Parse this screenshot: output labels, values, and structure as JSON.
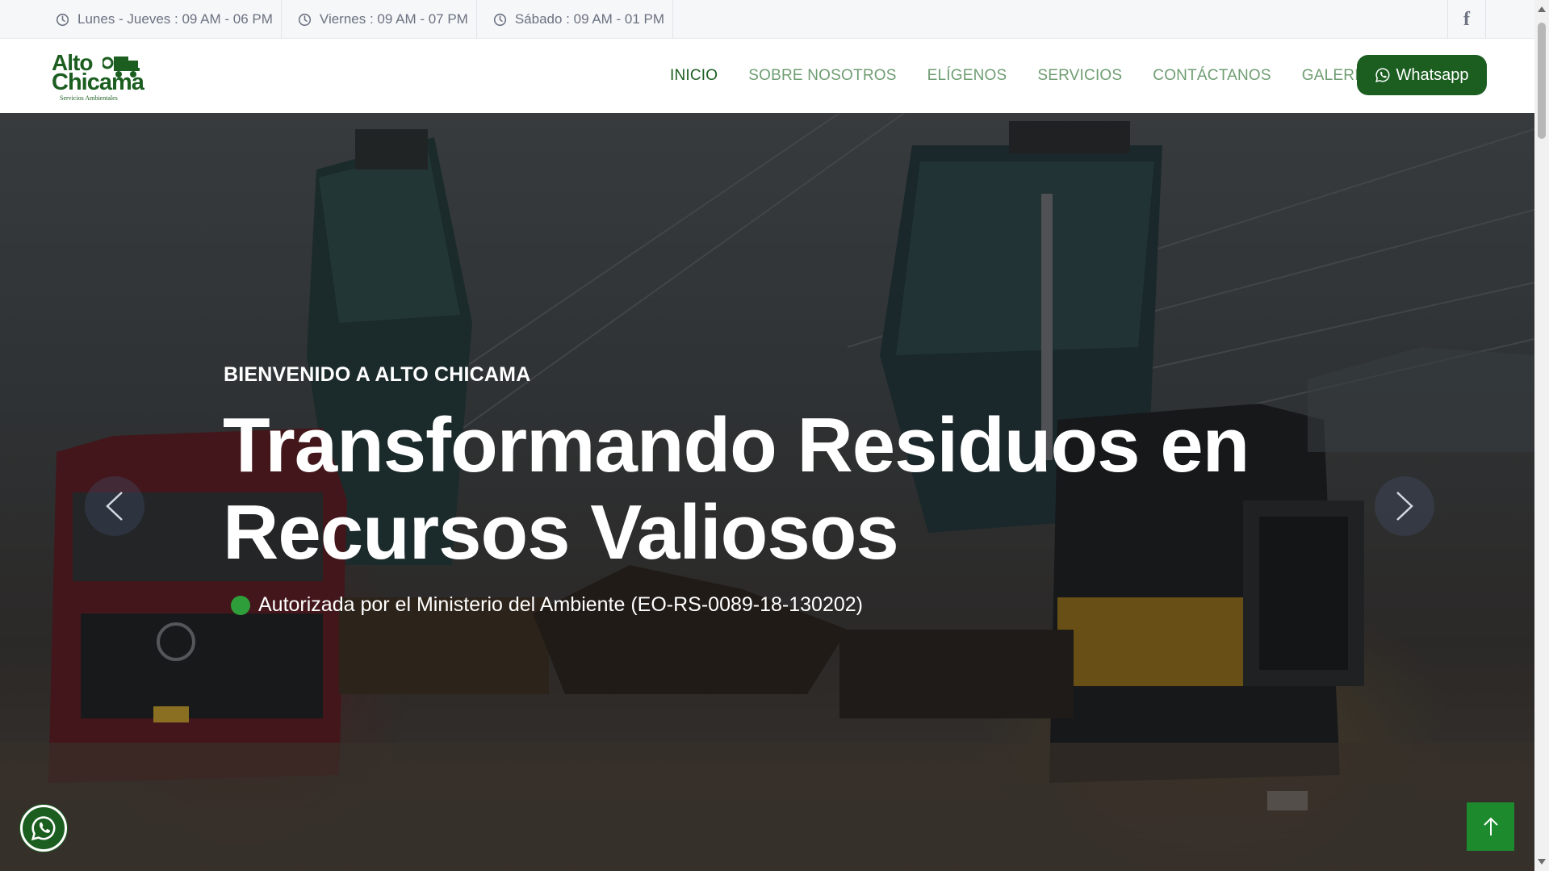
{
  "topbar": {
    "hours": [
      {
        "label": "Lunes - Jueves : 09 AM - 06 PM"
      },
      {
        "label": "Viernes : 09 AM - 07 PM"
      },
      {
        "label": "Sábado : 09 AM - 01 PM"
      }
    ],
    "social_icon": "facebook-icon",
    "social_glyph": "f"
  },
  "logo": {
    "line1": "Alto",
    "line2": "Chicama",
    "tagline": "Servicios Ambientales"
  },
  "nav": {
    "items": [
      {
        "label": "INICIO",
        "active": true
      },
      {
        "label": "SOBRE NOSOTROS"
      },
      {
        "label": "ELÍGENOS"
      },
      {
        "label": "SERVICIOS"
      },
      {
        "label": "CONTÁCTANOS"
      },
      {
        "label": "GALERIA"
      }
    ],
    "whatsapp_label": "Whatsapp"
  },
  "hero": {
    "kicker": "BIENVENIDO A ALTO CHICAMA",
    "title": "Transformando Residuos en Recursos Valiosos",
    "badge": "Autorizada por el Ministerio del Ambiente (EO-RS-0089-18-130202)"
  },
  "colors": {
    "brand_green": "#1b5e20",
    "nav_inactive": "#6f9d72",
    "badge_dot": "#2e9e3a",
    "scroll_top_button": "#1e8a2e"
  },
  "icons": {
    "hours": "clock-icon",
    "prev": "chevron-left-icon",
    "next": "chevron-right-icon",
    "whatsapp": "whatsapp-icon",
    "scroll_top": "arrow-up-icon"
  }
}
